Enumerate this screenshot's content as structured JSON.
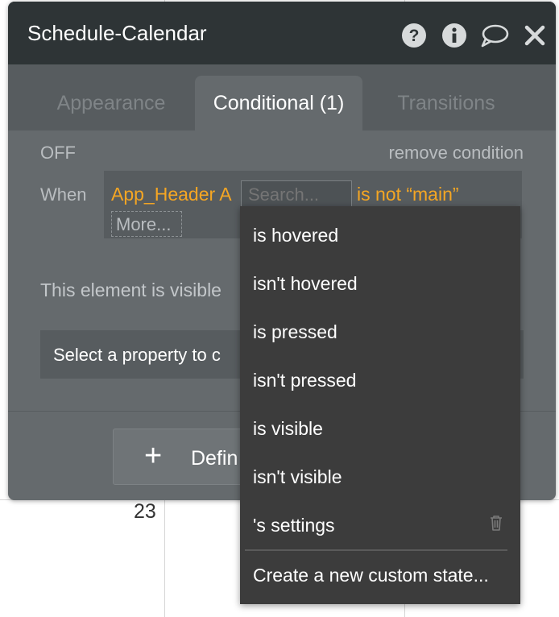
{
  "calendar": {
    "day_number": "23"
  },
  "window": {
    "title": "Schedule-Calendar",
    "icons": [
      "help-icon",
      "info-icon",
      "comment-icon",
      "close-icon"
    ]
  },
  "tabs": [
    {
      "label": "Appearance",
      "active": false
    },
    {
      "label": "Conditional (1)",
      "active": true
    },
    {
      "label": "Transitions",
      "active": false
    }
  ],
  "condition": {
    "state": "OFF",
    "remove_label": "remove condition",
    "when_label": "When",
    "expression_source": "App_Header A",
    "search_placeholder": "Search...",
    "expression_suffix": "is not “main”",
    "more_label": "More...",
    "visible_text": "This element is visible",
    "select_property_label": "Select a property to c",
    "accent_color": "#f5a623"
  },
  "define_button": {
    "label": "Defin"
  },
  "dropdown": {
    "items": [
      "is hovered",
      "isn't hovered",
      "is pressed",
      "isn't pressed",
      "is visible",
      "isn't visible",
      "'s settings"
    ],
    "create_label": "Create a new custom state..."
  }
}
